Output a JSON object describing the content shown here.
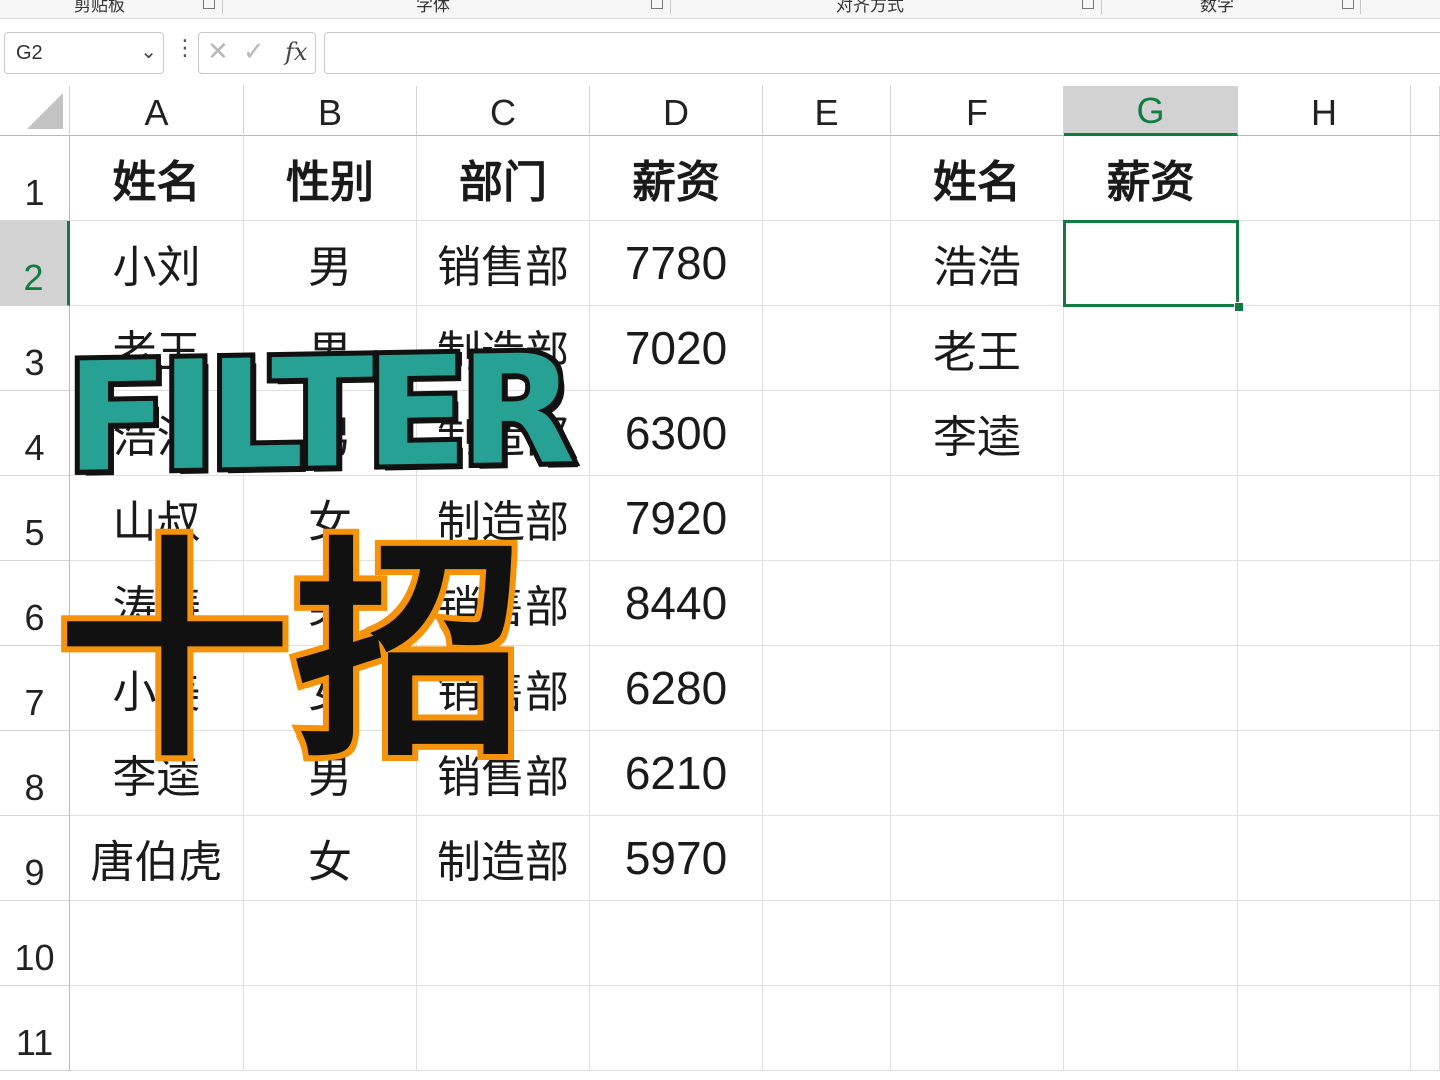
{
  "ribbon": {
    "groups": [
      "剪贴板",
      "字体",
      "对齐方式",
      "数字"
    ]
  },
  "formula_bar": {
    "name_box": "G2",
    "cancel_icon": "✕",
    "enter_icon": "✓",
    "fx_label": "fx",
    "formula": ""
  },
  "columns": [
    "A",
    "B",
    "C",
    "D",
    "E",
    "F",
    "G",
    "H"
  ],
  "rows": [
    "1",
    "2",
    "3",
    "4",
    "5",
    "6",
    "7",
    "8",
    "9",
    "10",
    "11"
  ],
  "selected_cell": "G2",
  "table": {
    "headers": [
      "姓名",
      "性别",
      "部门",
      "薪资"
    ],
    "rows": [
      [
        "小刘",
        "男",
        "销售部",
        "7780"
      ],
      [
        "老王",
        "男",
        "制造部",
        "7020"
      ],
      [
        "浩浩",
        "男",
        "制造部",
        "6300"
      ],
      [
        "山叔",
        "女",
        "制造部",
        "7920"
      ],
      [
        "涛涛",
        "男",
        "销售部",
        "8440"
      ],
      [
        "小美",
        "女",
        "销售部",
        "6280"
      ],
      [
        "李逵",
        "男",
        "销售部",
        "6210"
      ],
      [
        "唐伯虎",
        "女",
        "制造部",
        "5970"
      ]
    ]
  },
  "lookup": {
    "headers": [
      "姓名",
      "薪资"
    ],
    "names": [
      "浩浩",
      "老王",
      "李逵"
    ]
  },
  "overlay": {
    "title": "FILTER",
    "subtitle": "十招",
    "title_color": "#26a193",
    "subtitle_stroke_color": "#f5930a"
  },
  "colors": {
    "selection": "#107c41"
  }
}
